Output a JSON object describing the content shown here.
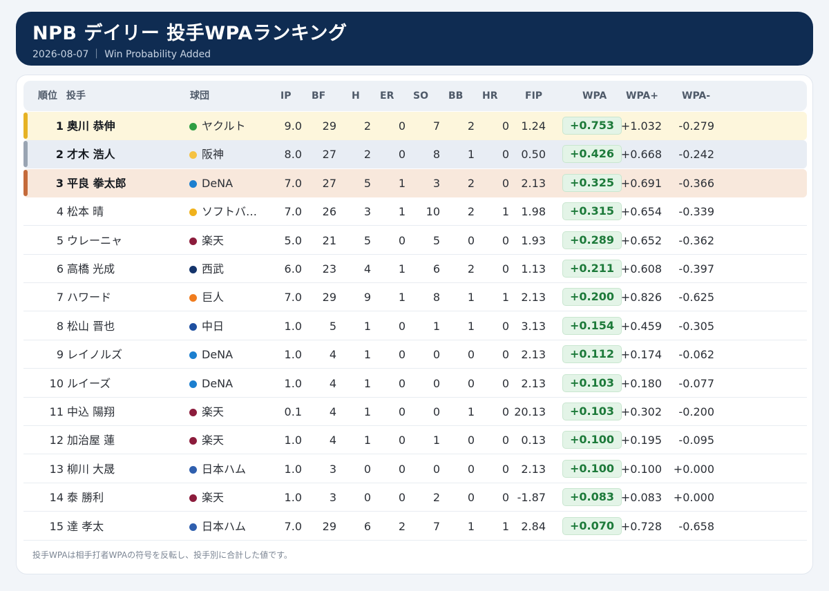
{
  "header": {
    "title": "NPB デイリー 投手WPAランキング",
    "subtitle": "2026-08-07 ｜ Win Probability Added"
  },
  "columns": {
    "rank": "順位",
    "pitcher": "投手",
    "team": "球団",
    "ip": "IP",
    "bf": "BF",
    "h": "H",
    "er": "ER",
    "so": "SO",
    "bb": "BB",
    "hr": "HR",
    "fip": "FIP",
    "wpa": "WPA",
    "wpa_plus": "WPA+",
    "wpa_minus": "WPA-"
  },
  "rows": [
    {
      "rank": "1",
      "name": "奥川 恭伸",
      "team": "ヤクルト",
      "team_color": "#2f9e44",
      "ip": "9.0",
      "bf": "29",
      "h": "2",
      "er": "0",
      "so": "7",
      "bb": "2",
      "hr": "0",
      "fip": "1.24",
      "wpa": "+0.753",
      "wpa_plus": "+1.032",
      "wpa_minus": "-0.279",
      "medal": "gold"
    },
    {
      "rank": "2",
      "name": "才木 浩人",
      "team": "阪神",
      "team_color": "#f5c242",
      "ip": "8.0",
      "bf": "27",
      "h": "2",
      "er": "0",
      "so": "8",
      "bb": "1",
      "hr": "0",
      "fip": "0.50",
      "wpa": "+0.426",
      "wpa_plus": "+0.668",
      "wpa_minus": "-0.242",
      "medal": "silver"
    },
    {
      "rank": "3",
      "name": "平良 拳太郎",
      "team": "DeNA",
      "team_color": "#1c7fcf",
      "ip": "7.0",
      "bf": "27",
      "h": "5",
      "er": "1",
      "so": "3",
      "bb": "2",
      "hr": "0",
      "fip": "2.13",
      "wpa": "+0.325",
      "wpa_plus": "+0.691",
      "wpa_minus": "-0.366",
      "medal": "bronze"
    },
    {
      "rank": "4",
      "name": "松本 晴",
      "team": "ソフトバ…",
      "team_color": "#f0b21c",
      "ip": "7.0",
      "bf": "26",
      "h": "3",
      "er": "1",
      "so": "10",
      "bb": "2",
      "hr": "1",
      "fip": "1.98",
      "wpa": "+0.315",
      "wpa_plus": "+0.654",
      "wpa_minus": "-0.339",
      "medal": ""
    },
    {
      "rank": "5",
      "name": "ウレーニャ",
      "team": "楽天",
      "team_color": "#8c1c3c",
      "ip": "5.0",
      "bf": "21",
      "h": "5",
      "er": "0",
      "so": "5",
      "bb": "0",
      "hr": "0",
      "fip": "1.93",
      "wpa": "+0.289",
      "wpa_plus": "+0.652",
      "wpa_minus": "-0.362",
      "medal": ""
    },
    {
      "rank": "6",
      "name": "高橋 光成",
      "team": "西武",
      "team_color": "#14346b",
      "ip": "6.0",
      "bf": "23",
      "h": "4",
      "er": "1",
      "so": "6",
      "bb": "2",
      "hr": "0",
      "fip": "1.13",
      "wpa": "+0.211",
      "wpa_plus": "+0.608",
      "wpa_minus": "-0.397",
      "medal": ""
    },
    {
      "rank": "7",
      "name": "ハワード",
      "team": "巨人",
      "team_color": "#f07c1e",
      "ip": "7.0",
      "bf": "29",
      "h": "9",
      "er": "1",
      "so": "8",
      "bb": "1",
      "hr": "1",
      "fip": "2.13",
      "wpa": "+0.200",
      "wpa_plus": "+0.826",
      "wpa_minus": "-0.625",
      "medal": ""
    },
    {
      "rank": "8",
      "name": "松山 晋也",
      "team": "中日",
      "team_color": "#1e4fa0",
      "ip": "1.0",
      "bf": "5",
      "h": "1",
      "er": "0",
      "so": "1",
      "bb": "1",
      "hr": "0",
      "fip": "3.13",
      "wpa": "+0.154",
      "wpa_plus": "+0.459",
      "wpa_minus": "-0.305",
      "medal": ""
    },
    {
      "rank": "9",
      "name": "レイノルズ",
      "team": "DeNA",
      "team_color": "#1c7fcf",
      "ip": "1.0",
      "bf": "4",
      "h": "1",
      "er": "0",
      "so": "0",
      "bb": "0",
      "hr": "0",
      "fip": "2.13",
      "wpa": "+0.112",
      "wpa_plus": "+0.174",
      "wpa_minus": "-0.062",
      "medal": ""
    },
    {
      "rank": "10",
      "name": "ルイーズ",
      "team": "DeNA",
      "team_color": "#1c7fcf",
      "ip": "1.0",
      "bf": "4",
      "h": "1",
      "er": "0",
      "so": "0",
      "bb": "0",
      "hr": "0",
      "fip": "2.13",
      "wpa": "+0.103",
      "wpa_plus": "+0.180",
      "wpa_minus": "-0.077",
      "medal": ""
    },
    {
      "rank": "11",
      "name": "中込 陽翔",
      "team": "楽天",
      "team_color": "#8c1c3c",
      "ip": "0.1",
      "bf": "4",
      "h": "1",
      "er": "0",
      "so": "0",
      "bb": "1",
      "hr": "0",
      "fip": "20.13",
      "wpa": "+0.103",
      "wpa_plus": "+0.302",
      "wpa_minus": "-0.200",
      "medal": ""
    },
    {
      "rank": "12",
      "name": "加治屋 蓮",
      "team": "楽天",
      "team_color": "#8c1c3c",
      "ip": "1.0",
      "bf": "4",
      "h": "1",
      "er": "0",
      "so": "1",
      "bb": "0",
      "hr": "0",
      "fip": "0.13",
      "wpa": "+0.100",
      "wpa_plus": "+0.195",
      "wpa_minus": "-0.095",
      "medal": ""
    },
    {
      "rank": "13",
      "name": "柳川 大晟",
      "team": "日本ハム",
      "team_color": "#2f5fae",
      "ip": "1.0",
      "bf": "3",
      "h": "0",
      "er": "0",
      "so": "0",
      "bb": "0",
      "hr": "0",
      "fip": "2.13",
      "wpa": "+0.100",
      "wpa_plus": "+0.100",
      "wpa_minus": "+0.000",
      "medal": ""
    },
    {
      "rank": "14",
      "name": "泰 勝利",
      "team": "楽天",
      "team_color": "#8c1c3c",
      "ip": "1.0",
      "bf": "3",
      "h": "0",
      "er": "0",
      "so": "2",
      "bb": "0",
      "hr": "0",
      "fip": "-1.87",
      "wpa": "+0.083",
      "wpa_plus": "+0.083",
      "wpa_minus": "+0.000",
      "medal": ""
    },
    {
      "rank": "15",
      "name": "達 孝太",
      "team": "日本ハム",
      "team_color": "#2f5fae",
      "ip": "7.0",
      "bf": "29",
      "h": "6",
      "er": "2",
      "so": "7",
      "bb": "1",
      "hr": "1",
      "fip": "2.84",
      "wpa": "+0.070",
      "wpa_plus": "+0.728",
      "wpa_minus": "-0.658",
      "medal": ""
    }
  ],
  "footnote": "投手WPAは相手打者WPAの符号を反転し、投手別に合計した値です。"
}
